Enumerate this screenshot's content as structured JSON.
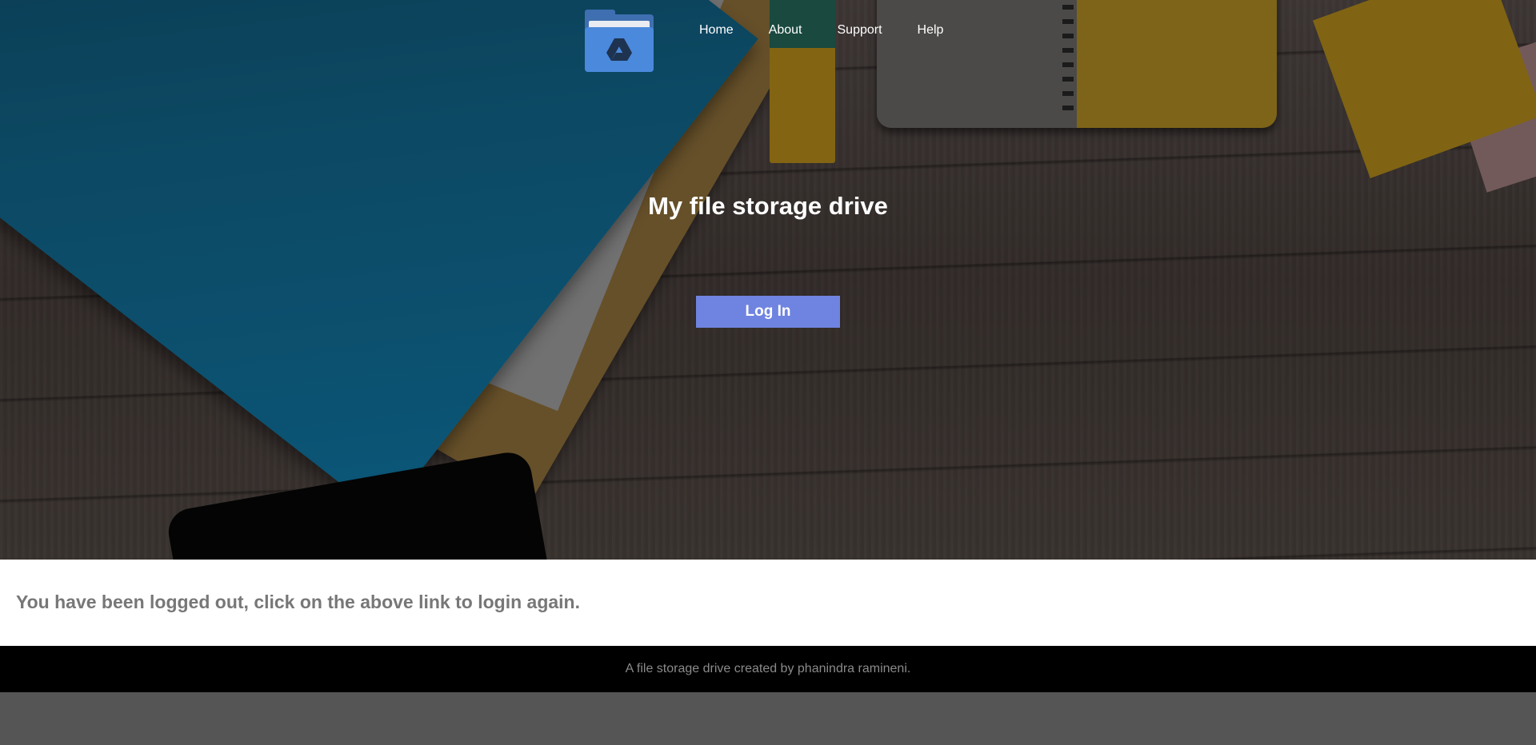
{
  "nav": {
    "logo_icon": "drive-folder-icon",
    "items": [
      {
        "label": "Home"
      },
      {
        "label": "About"
      },
      {
        "label": "Support"
      },
      {
        "label": "Help"
      }
    ]
  },
  "hero": {
    "title": "My file storage drive",
    "login_label": "Log In"
  },
  "message": {
    "text": "You have been logged out, click on the above link to login again."
  },
  "footer": {
    "text": "A file storage drive created by phanindra ramineni."
  },
  "colors": {
    "login_button": "#6f84e0",
    "logo_blue": "#4a89dc",
    "footer_bg": "#000000",
    "page_bg": "#555555"
  }
}
